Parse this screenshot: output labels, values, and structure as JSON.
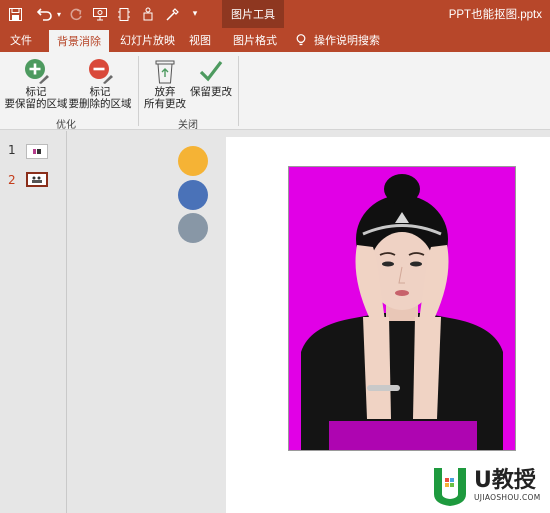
{
  "window": {
    "context_tab_group": "图片工具",
    "document_title": "PPT也能抠图.pptx"
  },
  "quick_access": {
    "icons": [
      "save-icon",
      "undo-icon",
      "redo-icon",
      "present-icon",
      "format-icon",
      "touch-icon",
      "eyedropper-icon",
      "customize-icon"
    ]
  },
  "tabs": {
    "file": "文件",
    "background_removal": "背景消除",
    "slideshow": "幻灯片放映",
    "view": "视图",
    "picture_format": "图片格式",
    "tell_me": "操作说明搜索"
  },
  "ribbon": {
    "mark_keep_line1": "标记",
    "mark_keep_line2": "要保留的区域",
    "mark_remove_line1": "标记",
    "mark_remove_line2": "要删除的区域",
    "group_refine": "优化",
    "discard_line1": "放弃",
    "discard_line2": "所有更改",
    "keep_changes": "保留更改",
    "group_close": "关闭"
  },
  "slides": [
    {
      "number": "1"
    },
    {
      "number": "2"
    }
  ],
  "colors": {
    "accent": "#b7472a",
    "dot_yellow": "#f5b335",
    "dot_blue": "#4a72b8",
    "dot_gray": "#8897a6",
    "removal_magenta": "#e100e6"
  },
  "watermark": {
    "brand": "U教授",
    "site": "UJIAOSHOU.COM"
  }
}
